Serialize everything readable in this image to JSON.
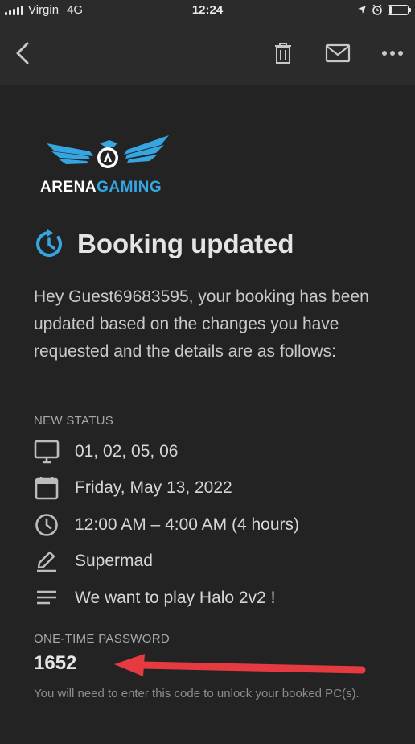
{
  "status_bar": {
    "carrier": "Virgin",
    "network": "4G",
    "time": "12:24"
  },
  "app_bar": {
    "back_icon": "chevron-left-icon",
    "delete_icon": "trash-icon",
    "mail_icon": "envelope-icon",
    "more_icon": "more-horizontal-icon"
  },
  "logo": {
    "word1": "ARENA",
    "word2": "GAMING",
    "brand_color": "#35a6e2"
  },
  "heading": {
    "icon": "refresh-clock-icon",
    "title": "Booking updated",
    "accent_color": "#35a6e2"
  },
  "intro": "Hey Guest69683595, your booking has been updated based on the changes you have requested and the details are as follows:",
  "status": {
    "label": "NEW STATUS",
    "items": [
      {
        "icon": "monitor-icon",
        "text": "01, 02, 05, 06"
      },
      {
        "icon": "calendar-icon",
        "text": "Friday, May 13, 2022"
      },
      {
        "icon": "clock-icon",
        "text": "12:00 AM – 4:00 AM (4 hours)"
      },
      {
        "icon": "pencil-icon",
        "text": "Supermad"
      },
      {
        "icon": "notes-icon",
        "text": "We want to play Halo 2v2 !"
      }
    ]
  },
  "otp": {
    "label": "ONE-TIME PASSWORD",
    "code": "1652",
    "note": "You will need to enter this code to unlock your booked PC(s)."
  },
  "annotation": {
    "arrow_color": "#e53a40"
  }
}
